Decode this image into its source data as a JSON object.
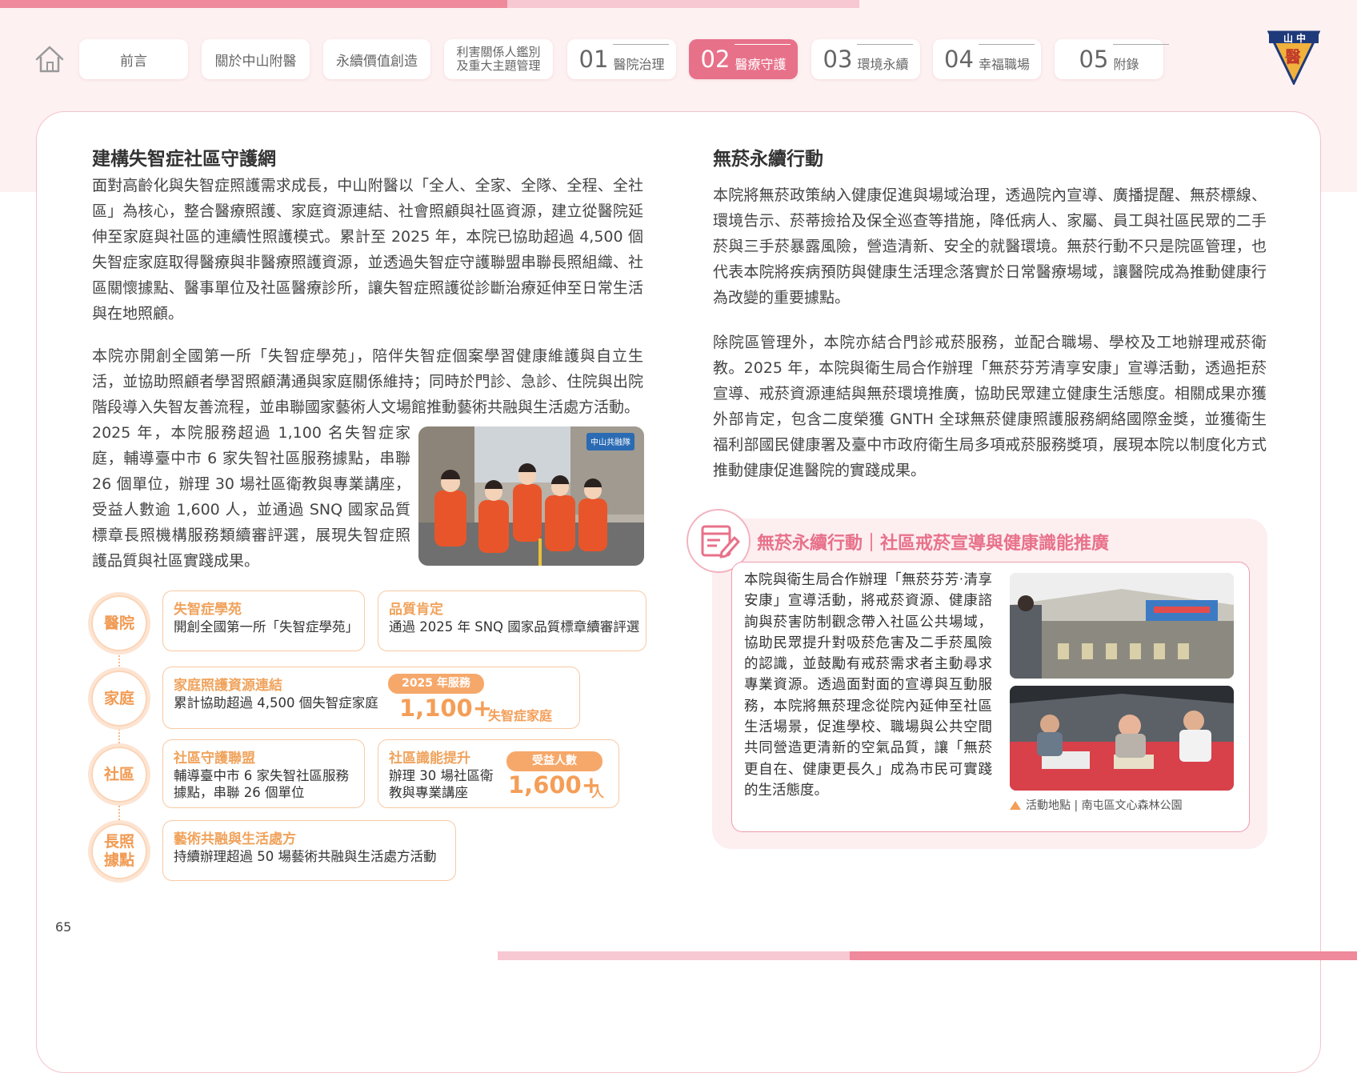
{
  "nav": {
    "tabs": [
      {
        "label": "前言"
      },
      {
        "label": "關於中山附醫"
      },
      {
        "label": "永續價值創造"
      },
      {
        "label": "利害關係人鑑別\n及重大主題管理"
      },
      {
        "num": "01",
        "label": "醫院治理"
      },
      {
        "num": "02",
        "label": "醫療守護"
      },
      {
        "num": "03",
        "label": "環境永續"
      },
      {
        "num": "04",
        "label": "幸福職場"
      },
      {
        "num": "05",
        "label": "附錄"
      }
    ]
  },
  "logo": {
    "text": "山中",
    "glyph": "醫"
  },
  "left": {
    "title": "建構失智症社區守護網",
    "para1": "面對高齡化與失智症照護需求成長，中山附醫以「全人、全家、全隊、全程、全社區」為核心，整合醫療照護、家庭資源連結、社會照顧與社區資源，建立從醫院延伸至家庭與社區的連續性照護模式。累計至 2025 年，本院已協助超過 4,500 個失智症家庭取得醫療與非醫療照護資源，並透過失智症守護聯盟串聯長照組織、社區關懷據點、醫事單位及社區醫療診所，讓失智症照護從診斷治療延伸至日常生活與在地照顧。",
    "para2": "本院亦開創全國第一所「失智症學苑」，陪伴失智症個案學習健康維護與自立生活，並協助照顧者學習照顧溝通與家庭關係維持；同時於門診、急診、住院與出院階段導入失智友善流程，並串聯國家藝術人文場館推動藝術共融與生活處方活動。",
    "para3": "2025 年，本院服務超過 1,100 名失智症家庭，輔導臺中市 6 家失智社區服務據點，串聯 26 個單位，辦理 30 場社區衛教與專業講座，受益人數逾 1,600 人，並通過 SNQ 國家品質標章長照機構服務類續審評選，展現失智症照護品質與社區實踐成果。",
    "photo_sign": "中山共融隊"
  },
  "infographic": {
    "levels": [
      "醫院",
      "家庭",
      "社區",
      "長照\n據點"
    ],
    "boxes": [
      {
        "title": "失智症學苑",
        "body": "開創全國第一所「失智症學苑」"
      },
      {
        "title": "品質肯定",
        "body": "通過 2025 年 SNQ 國家品質標章續審評選"
      },
      {
        "title": "家庭照護資源連結",
        "body": "累計協助超過 4,500 個失智症家庭",
        "pill": "2025 年服務",
        "stat": "1,100+",
        "unit": "失智症家庭"
      },
      {
        "title": "社區守護聯盟",
        "body": "輔導臺中市 6 家失智社區服務據點，串聯 26 個單位"
      },
      {
        "title": "社區識能提升",
        "body": "辦理 30 場社區衛教與專業講座",
        "pill": "受益人數",
        "stat": "1,600+",
        "unit": "人"
      },
      {
        "title": "藝術共融與生活處方",
        "body": "持續辦理超過 50 場藝術共融與生活處方活動"
      }
    ]
  },
  "right": {
    "title": "無菸永續行動",
    "para1": "本院將無菸政策納入健康促進與場域治理，透過院內宣導、廣播提醒、無菸標線、環境告示、菸蒂撿拾及保全巡查等措施，降低病人、家屬、員工與社區民眾的二手菸與三手菸暴露風險，營造清新、安全的就醫環境。無菸行動不只是院區管理，也代表本院將疾病預防與健康生活理念落實於日常醫療場域，讓醫院成為推動健康行為改變的重要據點。",
    "para2": "除院區管理外，本院亦結合門診戒菸服務，並配合職場、學校及工地辦理戒菸衛教。2025 年，本院與衛生局合作辦理「無菸芬芳清享安康」宣導活動，透過拒菸宣導、戒菸資源連結與無菸環境推廣，協助民眾建立健康生活態度。相關成果亦獲外部肯定，包含二度榮獲 GNTH 全球無菸健康照護服務網絡國際金獎，並獲衛生福利部國民健康署及臺中市政府衛生局多項戒菸服務獎項，展現本院以制度化方式推動健康促進醫院的實踐成果。"
  },
  "feature": {
    "title": "無菸永續行動｜社區戒菸宣導與健康識能推廣",
    "text": "本院與衛生局合作辦理「無菸芬芳‧清享安康」宣導活動，將戒菸資源、健康諮詢與菸害防制觀念帶入社區公共場域，協助民眾提升對吸菸危害及二手菸風險的認識，並鼓勵有戒菸需求者主動尋求專業資源。透過面對面的宣導與互動服務，本院將無菸理念從院內延伸至社區生活場景，促進學校、職場與公共空間共同營造更清新的空氣品質，讓「無菸更自在、健康更長久」成為市民可實踐的生活態度。",
    "caption": "活動地點 | 南屯區文心森林公園"
  },
  "page_number": "65",
  "colors": {
    "accent": "#e8718a",
    "orange": "#f49e57",
    "pink_bg": "#fdf1f2"
  }
}
